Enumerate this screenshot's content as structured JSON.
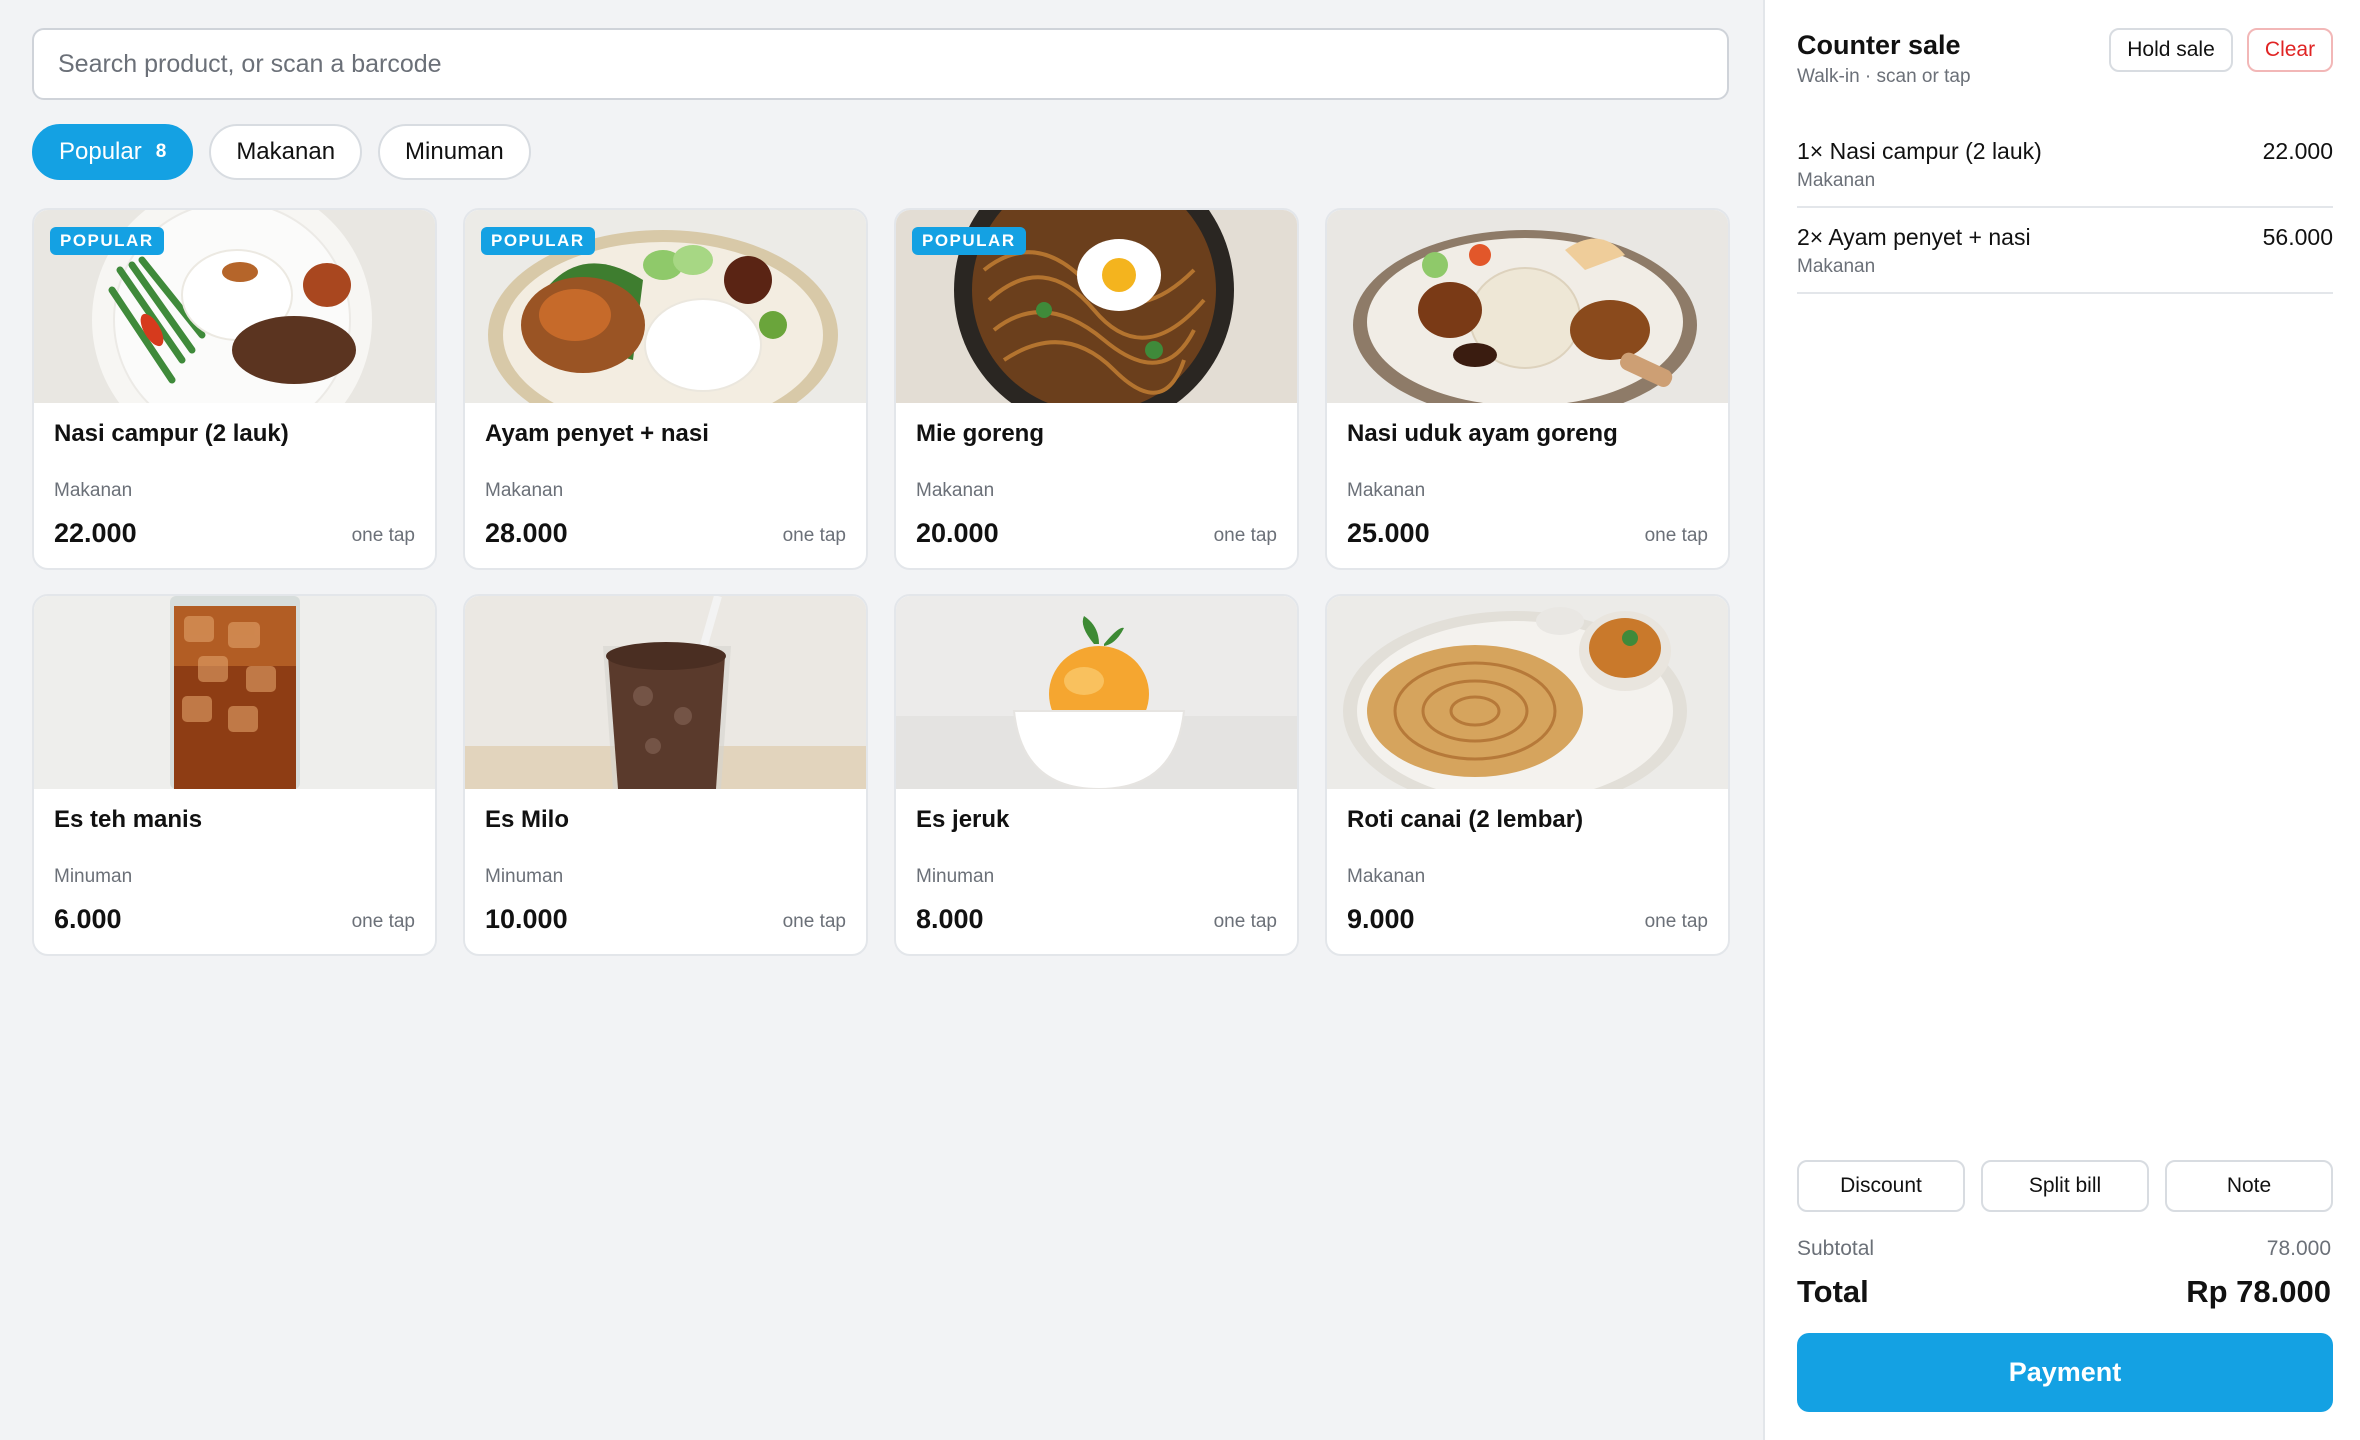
{
  "search": {
    "placeholder": "Search product, or scan a barcode"
  },
  "filters": [
    {
      "label": "Popular",
      "count": "8",
      "active": true
    },
    {
      "label": "Makanan"
    },
    {
      "label": "Minuman"
    }
  ],
  "products": [
    {
      "name": "Nasi campur (2 lauk)",
      "category": "Makanan",
      "price": "22.000",
      "tap": "one tap",
      "badge": "POPULAR",
      "image": "nasi-campur-plate"
    },
    {
      "name": "Ayam penyet + nasi",
      "category": "Makanan",
      "price": "28.000",
      "tap": "one tap",
      "badge": "POPULAR",
      "image": "ayam-penyet-plate"
    },
    {
      "name": "Mie goreng",
      "category": "Makanan",
      "price": "20.000",
      "tap": "one tap",
      "badge": "POPULAR",
      "image": "mie-goreng-bowl"
    },
    {
      "name": "Nasi uduk ayam goreng",
      "category": "Makanan",
      "price": "25.000",
      "tap": "one tap",
      "image": "nasi-uduk-plate"
    },
    {
      "name": "Es teh manis",
      "category": "Minuman",
      "price": "6.000",
      "tap": "one tap",
      "image": "iced-tea-glass"
    },
    {
      "name": "Es Milo",
      "category": "Minuman",
      "price": "10.000",
      "tap": "one tap",
      "image": "iced-milo-glass"
    },
    {
      "name": "Es jeruk",
      "category": "Minuman",
      "price": "8.000",
      "tap": "one tap",
      "image": "orange-sorbet-bowl"
    },
    {
      "name": "Roti canai (2 lembar)",
      "category": "Makanan",
      "price": "9.000",
      "tap": "one tap",
      "image": "roti-canai-plate"
    }
  ],
  "order": {
    "title": "Counter sale",
    "subtitle": "Walk-in · scan or tap",
    "hold_label": "Hold sale",
    "clear_label": "Clear",
    "items": [
      {
        "name": "1× Nasi campur (2 lauk)",
        "category": "Makanan",
        "price": "22.000"
      },
      {
        "name": "2× Ayam penyet + nasi",
        "category": "Makanan",
        "price": "56.000"
      }
    ],
    "actions": [
      "Discount",
      "Split bill",
      "Note"
    ],
    "subtotal_label": "Subtotal",
    "subtotal": "78.000",
    "total_label": "Total",
    "total": "Rp 78.000",
    "pay_label": "Payment"
  },
  "colors": {
    "accent": "#14a1e3",
    "danger": "#e02424",
    "muted": "#6b7078",
    "background": "#f2f3f5"
  }
}
